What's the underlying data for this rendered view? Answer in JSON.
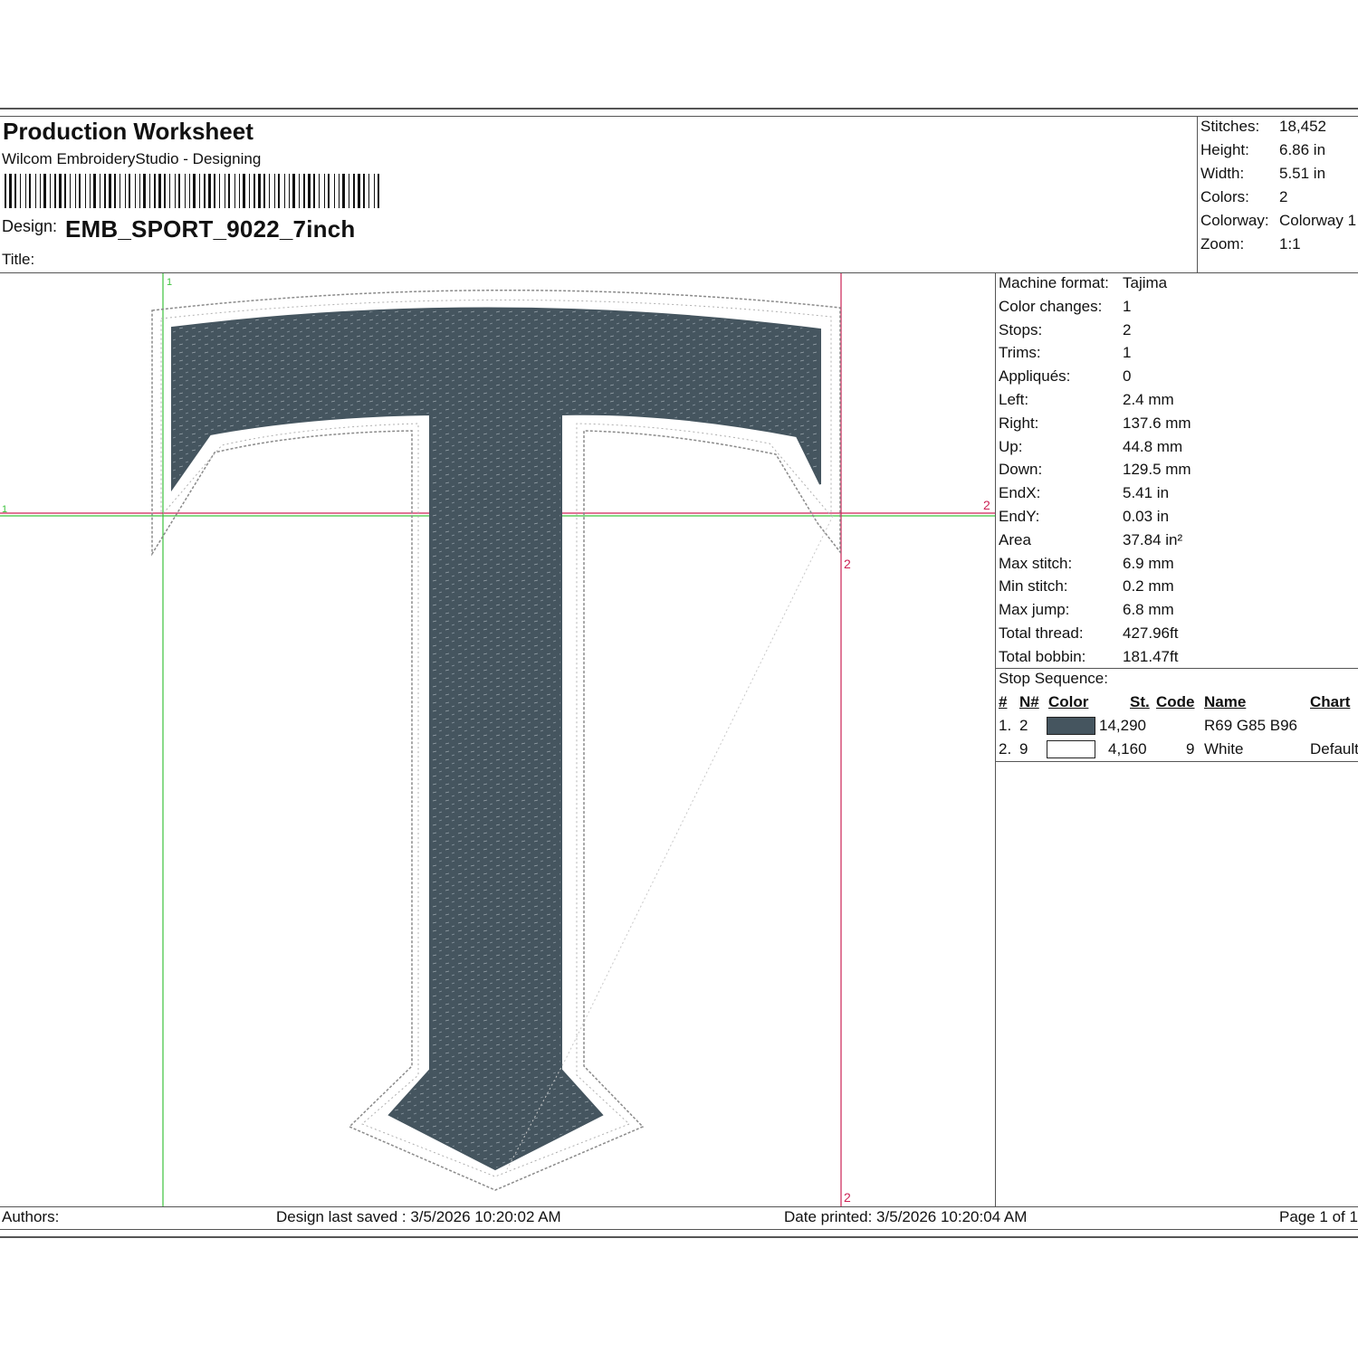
{
  "header": {
    "title": "Production Worksheet",
    "subtitle": "Wilcom EmbroideryStudio - Designing",
    "design_label": "Design:",
    "design_value": "EMB_SPORT_9022_7inch",
    "title_label": "Title:",
    "title_value": ""
  },
  "summary": [
    {
      "label": "Stitches:",
      "value": "18,452"
    },
    {
      "label": "Height:",
      "value": "6.86 in"
    },
    {
      "label": "Width:",
      "value": "5.51 in"
    },
    {
      "label": "Colors:",
      "value": "2"
    },
    {
      "label": "Colorway:",
      "value": "Colorway 1"
    },
    {
      "label": "Zoom:",
      "value": "1:1"
    }
  ],
  "details": [
    {
      "label": "Machine format:",
      "value": "Tajima"
    },
    {
      "label": "Color changes:",
      "value": "1"
    },
    {
      "label": "Stops:",
      "value": "2"
    },
    {
      "label": "Trims:",
      "value": "1"
    },
    {
      "label": "Appliqués:",
      "value": "0"
    },
    {
      "label": "Left:",
      "value": "2.4 mm"
    },
    {
      "label": "Right:",
      "value": "137.6 mm"
    },
    {
      "label": "Up:",
      "value": "44.8 mm"
    },
    {
      "label": "Down:",
      "value": "129.5 mm"
    },
    {
      "label": "EndX:",
      "value": "5.41 in"
    },
    {
      "label": "EndY:",
      "value": "0.03 in"
    },
    {
      "label": "Area",
      "value": " 37.84 in²"
    },
    {
      "label": "Max stitch:",
      "value": "6.9 mm"
    },
    {
      "label": "Min stitch:",
      "value": "0.2 mm"
    },
    {
      "label": "Max jump:",
      "value": "6.8 mm"
    },
    {
      "label": "Total thread:",
      "value": "427.96ft"
    },
    {
      "label": "Total bobbin:",
      "value": "181.47ft"
    }
  ],
  "stop_sequence": {
    "title": "Stop Sequence:",
    "headers": {
      "num": "#",
      "needle": "N#",
      "color": "Color",
      "stitches": "St.",
      "code": "Code",
      "name": "Name",
      "chart": "Chart"
    },
    "rows": [
      {
        "num": "1.",
        "needle": "2",
        "swatch": "#45555f",
        "stitches": "14,290",
        "code": "",
        "name": "R69 G85 B96",
        "chart": ""
      },
      {
        "num": "2.",
        "needle": "9",
        "swatch": "#ffffff",
        "stitches": "4,160",
        "code": "9",
        "name": "White",
        "chart": "Default"
      }
    ]
  },
  "canvas": {
    "guide_green_label": "1",
    "guide_red_label": "2",
    "thread_color": "#45555f",
    "guide_green_color": "#3cc23c",
    "guide_red_color": "#cc2255"
  },
  "footer": {
    "authors_label": "Authors:",
    "saved": "Design last saved : 3/5/2026 10:20:02 AM",
    "printed": "Date printed: 3/5/2026 10:20:04 AM",
    "page": "Page 1 of 1"
  }
}
